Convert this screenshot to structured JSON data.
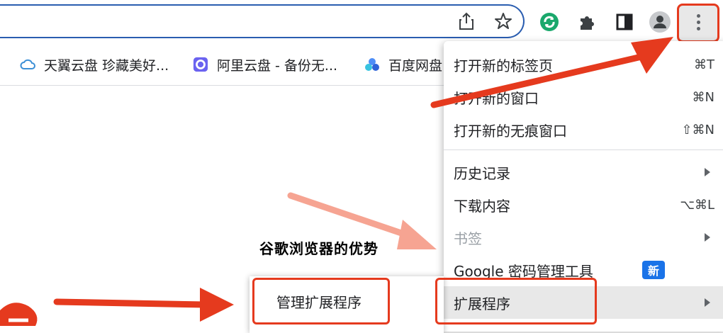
{
  "toolbar": {
    "icons": [
      "share-icon",
      "star-icon",
      "extension-green-icon",
      "puzzle-icon",
      "sidepanel-icon",
      "profile-icon",
      "more-vert-icon"
    ]
  },
  "bookmarks": [
    {
      "label": "天翼云盘 珍藏美好...",
      "icon": "cloud-icon"
    },
    {
      "label": "阿里云盘 - 备份无...",
      "icon": "aliyun-icon"
    },
    {
      "label": "百度网盘",
      "icon": "baidu-netdisk-icon"
    }
  ],
  "menu": {
    "items": [
      {
        "label": "打开新的标签页",
        "shortcut": "⌘T"
      },
      {
        "label": "打开新的窗口",
        "shortcut": "⌘N"
      },
      {
        "label": "打开新的无痕窗口",
        "shortcut": "⇧⌘N"
      },
      {
        "label": "历史记录",
        "shortcut": ""
      },
      {
        "label": "下载内容",
        "shortcut": "⌥⌘L"
      },
      {
        "label": "书签",
        "shortcut": ""
      },
      {
        "label": "Google 密码管理工具",
        "badge": "新"
      },
      {
        "label": "扩展程序",
        "shortcut": ""
      }
    ]
  },
  "submenu": {
    "items": [
      {
        "label": "管理扩展程序"
      }
    ]
  },
  "caption": "谷歌浏览器的优势",
  "colors": {
    "accent_red": "#e53a1e",
    "badge_blue": "#1a73e8",
    "omnibox_border": "#2a5db0"
  }
}
